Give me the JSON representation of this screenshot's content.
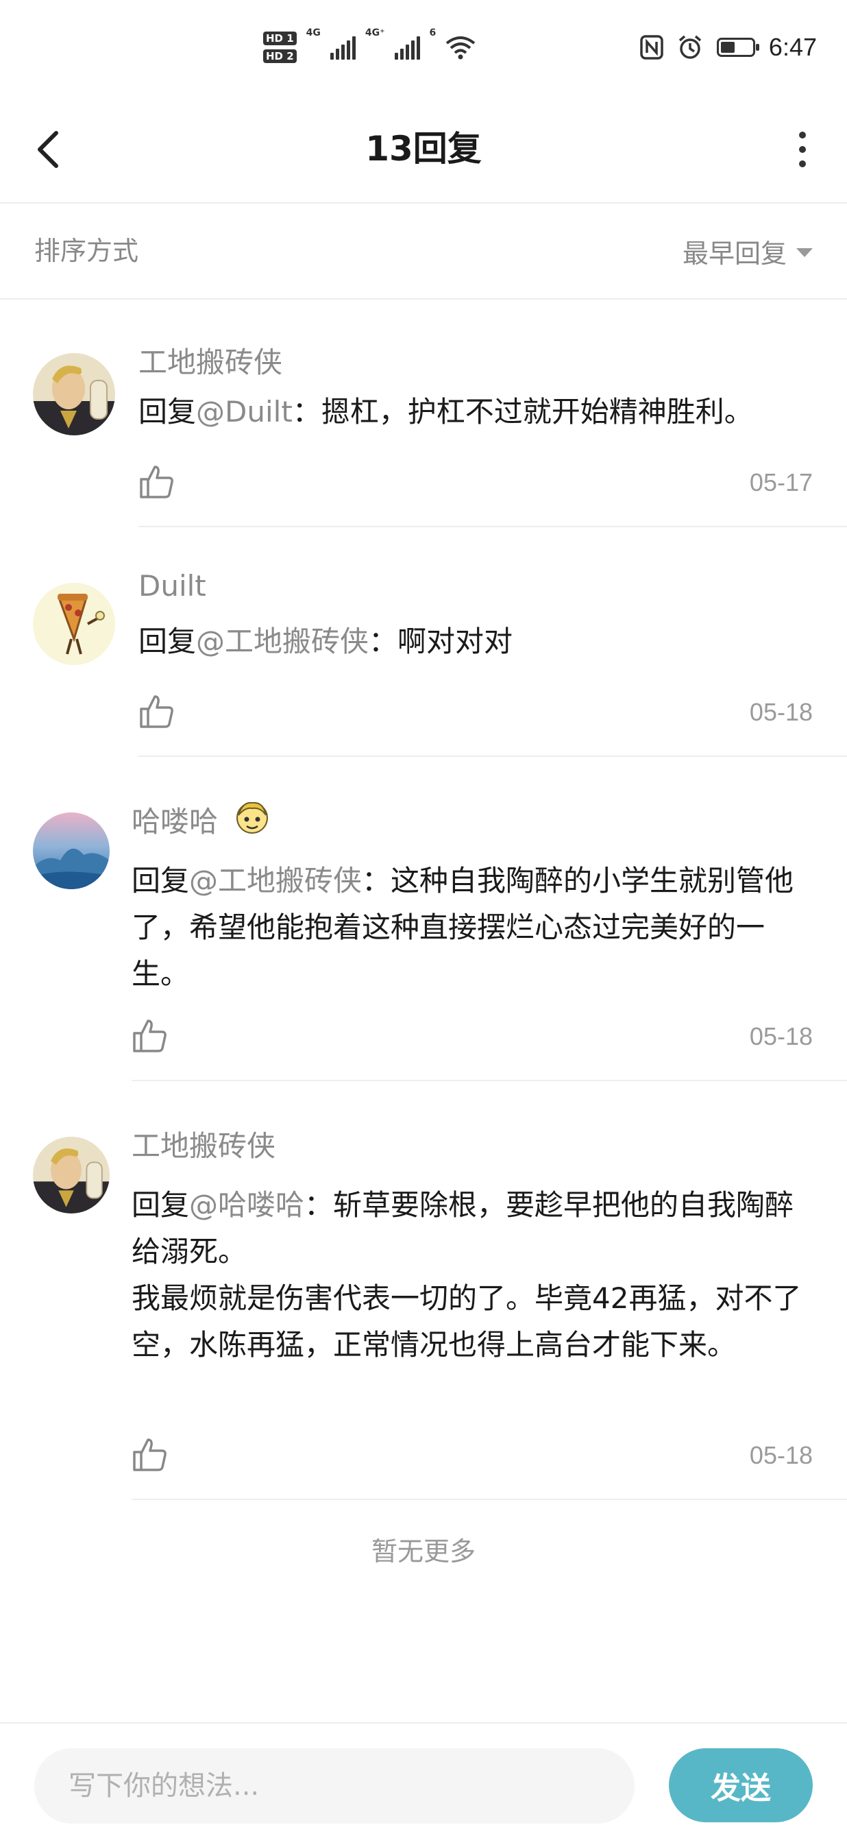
{
  "status_bar": {
    "sim1": "HD 1",
    "sim2": "HD 2",
    "net1": "4G",
    "net2": "4G⁺",
    "wifi": "6",
    "time": "6:47",
    "battery_level": 0.45,
    "icons": [
      "nfc-icon",
      "alarm-icon",
      "battery-icon"
    ]
  },
  "header": {
    "title": "13回复",
    "back_icon": "chevron-left-icon",
    "more_icon": "more-vertical-icon"
  },
  "sort": {
    "label": "排序方式",
    "selected": "最早回复"
  },
  "replies": [
    {
      "name": "工地搬砖侠",
      "prefix": "回复",
      "mention": "@Duilt",
      "text": "：摁杠，护杠不过就开始精神胜利。",
      "date": "05-17",
      "avatar": "avatar-cartoon-man"
    },
    {
      "name": "Duilt",
      "prefix": "回复",
      "mention": "@工地搬砖侠",
      "text": "：啊对对对",
      "date": "05-18",
      "avatar": "avatar-cartoon-pizza"
    },
    {
      "name": "哈喽哈",
      "badge": "emoji-badge-icon",
      "prefix": "回复",
      "mention": "@工地搬砖侠",
      "text": "：这种自我陶醉的小学生就别管他了，希望他能抱着这种直接摆烂心态过完美好的一生。",
      "date": "05-18",
      "avatar": "avatar-landscape"
    },
    {
      "name": "工地搬砖侠",
      "prefix": "回复",
      "mention": "@哈喽哈",
      "text": "：斩草要除根，要趁早把他的自我陶醉给溺死。\n我最烦就是伤害代表一切的了。毕竟42再猛，对不了空，水陈再猛，正常情况也得上高台才能下来。",
      "date": "05-18",
      "avatar": "avatar-cartoon-man"
    }
  ],
  "footer_note": "暂无更多",
  "composer": {
    "placeholder": "写下你的想法...",
    "send_label": "发送"
  },
  "colors": {
    "accent": "#58b7c6",
    "muted_text": "#8a8a8a",
    "divider": "#eeeeee"
  }
}
